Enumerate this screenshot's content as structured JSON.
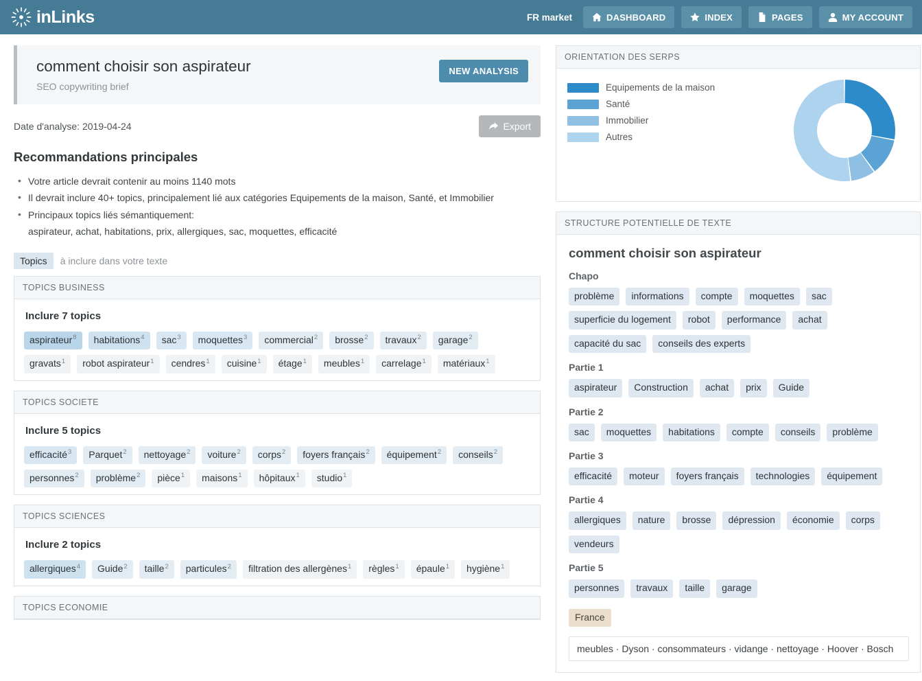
{
  "topnav": {
    "brand": "inLinks",
    "brand_icon": "starburst-icon",
    "market": "FR market",
    "buttons": [
      {
        "label": "DASHBOARD",
        "icon": "home-icon"
      },
      {
        "label": "INDEX",
        "icon": "star-icon"
      },
      {
        "label": "PAGES",
        "icon": "file-icon"
      },
      {
        "label": "MY ACCOUNT",
        "icon": "user-icon"
      }
    ],
    "bg_color": "#457b95",
    "button_color": "#5a91a9"
  },
  "brief": {
    "title": "comment choisir son aspirateur",
    "subtitle": "SEO copywriting brief",
    "new_analysis_label": "NEW ANALYSIS",
    "new_analysis_color": "#4d8cad",
    "date_line": "Date d'analyse: 2019-04-24",
    "export_label": "Export",
    "export_icon": "share-arrow-icon"
  },
  "recommendations": {
    "heading": "Recommandations principales",
    "bullets": [
      "Votre article devrait contenir au moins 1140 mots",
      "Il devrait inclure 40+ topics, principalement lié aux catégories Equipements de la maison, Santé, et Immobilier",
      "Principaux topics liés sémantiquement:"
    ],
    "semantic_topics": "aspirateur, achat, habitations, prix, allergiques, sac, moquettes, efficacité"
  },
  "topics_tab": {
    "chip_label": "Topics",
    "note": "à inclure dans votre texte"
  },
  "topic_panels": [
    {
      "header": "TOPICS BUSINESS",
      "include_line": "Inclure 7 topics",
      "chips": [
        {
          "label": "aspirateur",
          "count": 8
        },
        {
          "label": "habitations",
          "count": 4
        },
        {
          "label": "sac",
          "count": 3
        },
        {
          "label": "moquettes",
          "count": 3
        },
        {
          "label": "commercial",
          "count": 2
        },
        {
          "label": "brosse",
          "count": 2
        },
        {
          "label": "travaux",
          "count": 2
        },
        {
          "label": "garage",
          "count": 2
        },
        {
          "label": "gravats",
          "count": 1
        },
        {
          "label": "robot aspirateur",
          "count": 1
        },
        {
          "label": "cendres",
          "count": 1
        },
        {
          "label": "cuisine",
          "count": 1
        },
        {
          "label": "étage",
          "count": 1
        },
        {
          "label": "meubles",
          "count": 1
        },
        {
          "label": "carrelage",
          "count": 1
        },
        {
          "label": "matériaux",
          "count": 1
        }
      ]
    },
    {
      "header": "TOPICS SOCIETE",
      "include_line": "Inclure 5 topics",
      "chips": [
        {
          "label": "efficacité",
          "count": 3
        },
        {
          "label": "Parquet",
          "count": 2
        },
        {
          "label": "nettoyage",
          "count": 2
        },
        {
          "label": "voiture",
          "count": 2
        },
        {
          "label": "corps",
          "count": 2
        },
        {
          "label": "foyers français",
          "count": 2
        },
        {
          "label": "équipement",
          "count": 2
        },
        {
          "label": "conseils",
          "count": 2
        },
        {
          "label": "personnes",
          "count": 2
        },
        {
          "label": "problème",
          "count": 2
        },
        {
          "label": "pièce",
          "count": 1
        },
        {
          "label": "maisons",
          "count": 1
        },
        {
          "label": "hôpitaux",
          "count": 1
        },
        {
          "label": "studio",
          "count": 1
        }
      ]
    },
    {
      "header": "TOPICS SCIENCES",
      "include_line": "Inclure 2 topics",
      "chips": [
        {
          "label": "allergiques",
          "count": 4
        },
        {
          "label": "Guide",
          "count": 2
        },
        {
          "label": "taille",
          "count": 2
        },
        {
          "label": "particules",
          "count": 2
        },
        {
          "label": "filtration des allergènes",
          "count": 1
        },
        {
          "label": "règles",
          "count": 1
        },
        {
          "label": "épaule",
          "count": 1
        },
        {
          "label": "hygiène",
          "count": 1
        }
      ]
    },
    {
      "header": "TOPICS ECONOMIE",
      "include_line": "",
      "chips": []
    }
  ],
  "serp": {
    "header": "ORIENTATION DES SERPS",
    "chart_data": {
      "type": "pie",
      "title": "ORIENTATION DES SERPS",
      "legend_position": "left",
      "categories": [
        "Equipements de la maison",
        "Santé",
        "Immobilier",
        "Autres"
      ],
      "values": [
        28,
        12,
        8,
        52
      ],
      "colors": [
        "#2e8bc9",
        "#5ba3d4",
        "#8fc0e3",
        "#aed3ee"
      ],
      "donut": true
    }
  },
  "structure": {
    "header": "STRUCTURE POTENTIELLE DE TEXTE",
    "doc_title": "comment choisir son aspirateur",
    "sections": [
      {
        "label": "Chapo",
        "chips": [
          "problème",
          "informations",
          "compte",
          "moquettes",
          "sac",
          "superficie du logement",
          "robot",
          "performance",
          "achat",
          "capacité du sac",
          "conseils des experts"
        ]
      },
      {
        "label": "Partie 1",
        "chips": [
          "aspirateur",
          "Construction",
          "achat",
          "prix",
          "Guide"
        ]
      },
      {
        "label": "Partie 2",
        "chips": [
          "sac",
          "moquettes",
          "habitations",
          "compte",
          "conseils",
          "problème"
        ]
      },
      {
        "label": "Partie 3",
        "chips": [
          "efficacité",
          "moteur",
          "foyers français",
          "technologies",
          "équipement"
        ]
      },
      {
        "label": "Partie 4",
        "chips": [
          "allergiques",
          "nature",
          "brosse",
          "dépression",
          "économie",
          "corps",
          "vendeurs"
        ]
      },
      {
        "label": "Partie 5",
        "chips": [
          "personnes",
          "travaux",
          "taille",
          "garage"
        ]
      }
    ],
    "entities": [
      "France"
    ],
    "footer_terms": "meubles · Dyson · consommateurs · vidange · nettoyage · Hoover · Bosch"
  }
}
